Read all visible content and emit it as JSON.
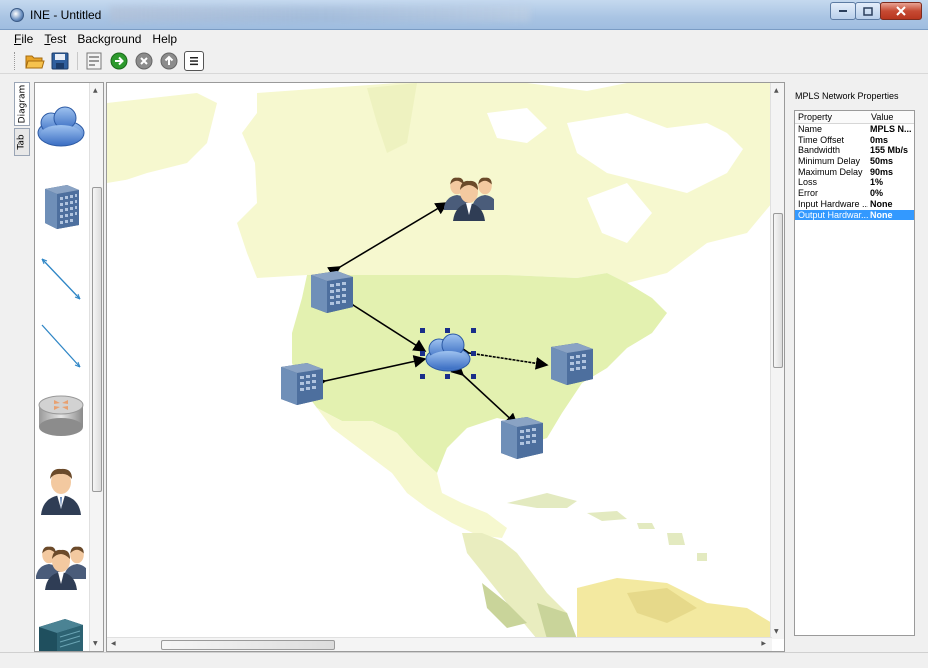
{
  "window": {
    "title": "INE - Untitled"
  },
  "menu": [
    {
      "acc": "F",
      "rest": "ile"
    },
    {
      "acc": "T",
      "rest": "est"
    },
    {
      "acc": "",
      "rest": "Background"
    },
    {
      "acc": "",
      "rest": "Help"
    }
  ],
  "toolbar": {
    "icons": [
      "open-folder-icon",
      "save-icon",
      "properties-icon",
      "run-icon",
      "stop-icon",
      "upload-icon",
      "list-icon"
    ]
  },
  "side_tabs": {
    "diagram": "Diagram",
    "tab": "Tab"
  },
  "palette": {
    "items": [
      "cloud-icon",
      "building-icon",
      "link-icon",
      "link-icon",
      "router-icon",
      "user-icon",
      "user-group-icon",
      "switch-icon"
    ]
  },
  "properties": {
    "title": "MPLS Network Properties",
    "col_property": "Property",
    "col_value": "Value",
    "rows": [
      {
        "key": "Name",
        "value": "MPLS N..."
      },
      {
        "key": "Time Offset",
        "value": "0ms"
      },
      {
        "key": "Bandwidth",
        "value": "155 Mb/s"
      },
      {
        "key": "Minimum Delay",
        "value": "50ms"
      },
      {
        "key": "Maximum Delay",
        "value": "90ms"
      },
      {
        "key": "Loss",
        "value": "1%"
      },
      {
        "key": "Error",
        "value": "0%"
      },
      {
        "key": "Input Hardware ...",
        "value": "None"
      },
      {
        "key": "Output Hardwar...",
        "value": "None"
      }
    ],
    "selected_index": 8
  },
  "colors": {
    "map_land": "#f6f8cf",
    "map_usa": "#e3f1b0",
    "map_dark": "#c9d49a",
    "selection": "#3399ff",
    "cloud": "#5d8fd6"
  }
}
